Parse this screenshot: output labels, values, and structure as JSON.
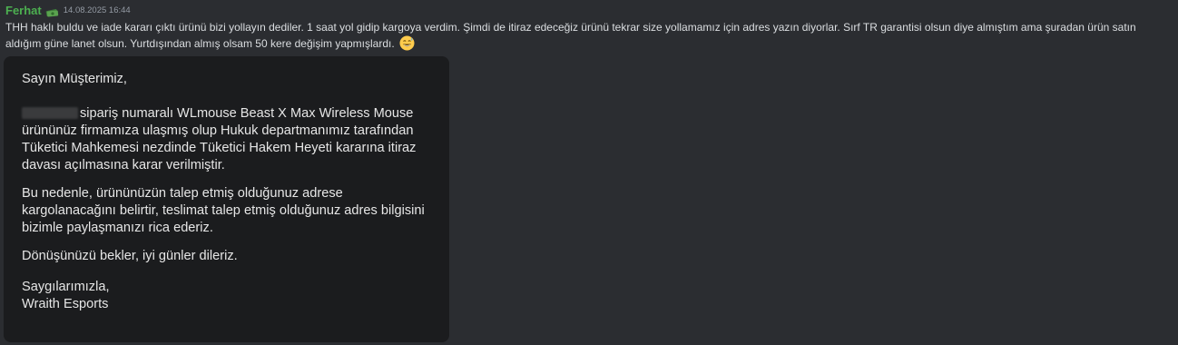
{
  "message": {
    "author": "Ferhat",
    "author_color": "#4caf50",
    "author_badge_icon": "money-bundle-icon",
    "timestamp": "14.08.2025 16:44",
    "text": "THH haklı buldu ve iade kararı çıktı ürünü bizi yollayın dediler. 1 saat yol gidip kargoya verdim. Şimdi de itiraz edeceğiz ürünü tekrar size yollamamız için adres yazın diyorlar. Sırf TR garantisi olsun diye almıştım ama şuradan ürün satın aldığım güne lanet olsun. Yurtdışından almış olsam 50 kere değişim yapmışlardı.",
    "emoji": "grinning-sweat-face-icon"
  },
  "attachment": {
    "greeting": "Sayın Müşterimiz,",
    "body1": "sipariş numaralı WLmouse Beast X Max Wireless Mouse ürününüz firmamıza ulaşmış olup Hukuk departmanımız tarafından Tüketici Mahkemesi nezdinde Tüketici Hakem Heyeti kararına itiraz davası açılmasına karar verilmiştir.",
    "body2": "Bu nedenle, ürününüzün talep etmiş olduğunuz adrese kargolanacağını belirtir, teslimat talep etmiş olduğunuz adres bilgisini bizimle paylaşmanızı rica ederiz.",
    "body3": "Dönüşünüzü bekler, iyi günler dileriz.",
    "closing": "Saygılarımızla,",
    "signature": "Wraith Esports"
  }
}
